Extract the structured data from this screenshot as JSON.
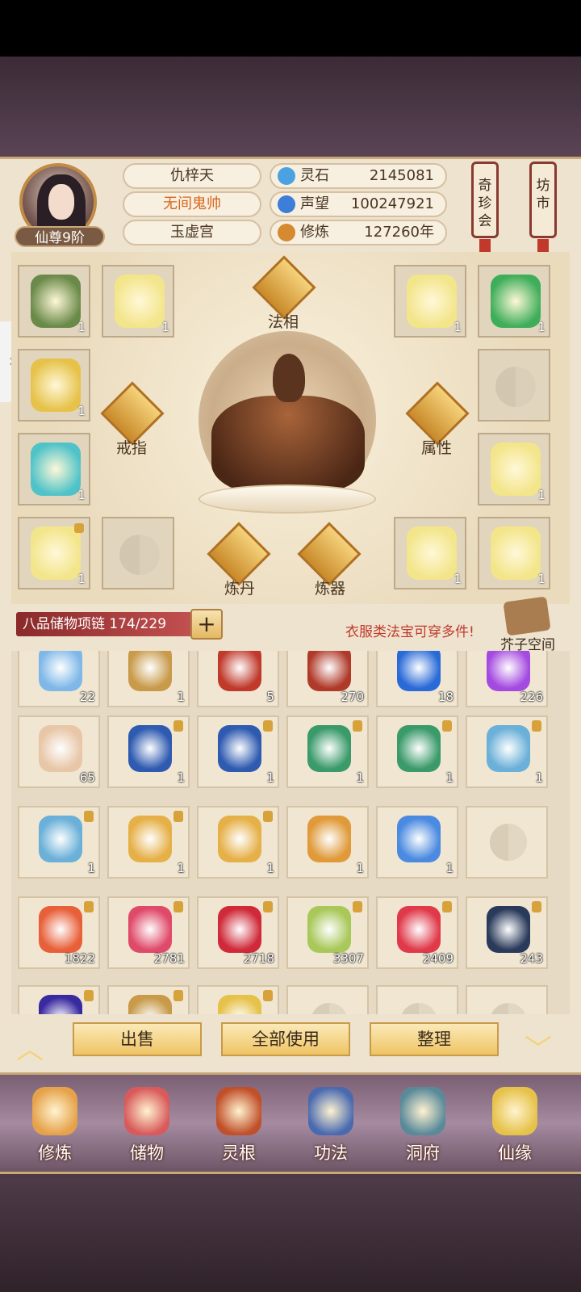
{
  "player": {
    "name": "仇梓天",
    "title": "无间鬼帅",
    "sect": "玉虚宫",
    "rank": "仙尊9阶"
  },
  "stats": [
    {
      "label": "灵石",
      "value": "2145081",
      "icon": "spirit-stone-icon",
      "color": "#4aa3e0"
    },
    {
      "label": "声望",
      "value": "100247921",
      "icon": "prestige-icon",
      "color": "#3c7ed8"
    },
    {
      "label": "修炼",
      "value": "127260年",
      "icon": "cultivation-icon",
      "color": "#d58a30"
    }
  ],
  "top_buttons": {
    "treasure_fair": "奇珍会",
    "market": "坊市"
  },
  "equip_labels": {
    "faxiang": "法相",
    "ring": "戒指",
    "attribute": "属性",
    "alchemy": "炼丹",
    "forging": "炼器"
  },
  "equip_slots": [
    {
      "count": "1",
      "color": "#6a8a4a",
      "locked": false
    },
    {
      "count": "1",
      "color": "#f3e58a",
      "locked": false
    },
    {
      "count": "1",
      "color": "#f3e58a",
      "locked": false
    },
    {
      "count": "1",
      "color": "#3fae5a",
      "locked": false
    },
    {
      "count": "1",
      "color": "#e6c24a",
      "locked": false
    },
    {
      "count": "",
      "color": "",
      "locked": false
    },
    {
      "count": "1",
      "color": "#4fc3c8",
      "locked": false
    },
    {
      "count": "1",
      "color": "#f3e58a",
      "locked": false
    },
    {
      "count": "1",
      "color": "#f3e58a",
      "locked": true
    },
    {
      "count": "",
      "color": "",
      "locked": false
    },
    {
      "count": "1",
      "color": "#f3e58a",
      "locked": false
    },
    {
      "count": "1",
      "color": "#f3e58a",
      "locked": false
    }
  ],
  "storage": {
    "label": "八品储物项链 174/229",
    "tip": "衣服类法宝可穿多件!",
    "bag_label": "芥子空间",
    "plus": "+"
  },
  "grid": [
    {
      "count": "22",
      "color": "#7fb8e8",
      "locked": false
    },
    {
      "count": "1",
      "color": "#c89a4a",
      "locked": false
    },
    {
      "count": "5",
      "color": "#c0392b",
      "locked": false
    },
    {
      "count": "270",
      "color": "#b03a2a",
      "locked": false
    },
    {
      "count": "18",
      "color": "#2a6ad8",
      "locked": false
    },
    {
      "count": "226",
      "color": "#a44ae0",
      "locked": false
    },
    {
      "count": "65",
      "color": "#e8c7a8",
      "locked": false
    },
    {
      "count": "1",
      "color": "#2e5ab0",
      "locked": true
    },
    {
      "count": "1",
      "color": "#2e5ab0",
      "locked": true
    },
    {
      "count": "1",
      "color": "#3a9a6a",
      "locked": true
    },
    {
      "count": "1",
      "color": "#3a9a6a",
      "locked": true
    },
    {
      "count": "1",
      "color": "#6ab0d8",
      "locked": true
    },
    {
      "count": "1",
      "color": "#6ab0d8",
      "locked": true
    },
    {
      "count": "1",
      "color": "#e6b048",
      "locked": true
    },
    {
      "count": "1",
      "color": "#e6b048",
      "locked": true
    },
    {
      "count": "1",
      "color": "#e09a3a",
      "locked": false
    },
    {
      "count": "1",
      "color": "#4a8ae0",
      "locked": false
    },
    {
      "count": "",
      "color": "",
      "locked": false
    },
    {
      "count": "1822",
      "color": "#e8603a",
      "locked": true
    },
    {
      "count": "2781",
      "color": "#e04a6a",
      "locked": true
    },
    {
      "count": "2718",
      "color": "#d02a3a",
      "locked": true
    },
    {
      "count": "3307",
      "color": "#a8c85a",
      "locked": true
    },
    {
      "count": "2409",
      "color": "#e03a4a",
      "locked": true
    },
    {
      "count": "243",
      "color": "#2a3a5a",
      "locked": true
    },
    {
      "count": "",
      "color": "#3a2aa0",
      "locked": true
    },
    {
      "count": "",
      "color": "#c89a4a",
      "locked": true
    },
    {
      "count": "",
      "color": "#e6c24a",
      "locked": true
    },
    {
      "count": "",
      "color": "",
      "locked": false
    },
    {
      "count": "",
      "color": "",
      "locked": false
    },
    {
      "count": "",
      "color": "",
      "locked": false
    }
  ],
  "actions": {
    "sell": "出售",
    "use_all": "全部使用",
    "sort": "整理"
  },
  "nav": [
    {
      "label": "修炼",
      "icon": "cultivate-nav-icon",
      "color": "#e6a24a"
    },
    {
      "label": "储物",
      "icon": "storage-nav-icon",
      "color": "#d85a5a"
    },
    {
      "label": "灵根",
      "icon": "spirit-root-nav-icon",
      "color": "#c0502a"
    },
    {
      "label": "功法",
      "icon": "technique-nav-icon",
      "color": "#4a6ab0"
    },
    {
      "label": "洞府",
      "icon": "cave-nav-icon",
      "color": "#5a8a9a"
    },
    {
      "label": "仙缘",
      "icon": "fate-nav-icon",
      "color": "#e6c24a"
    }
  ]
}
